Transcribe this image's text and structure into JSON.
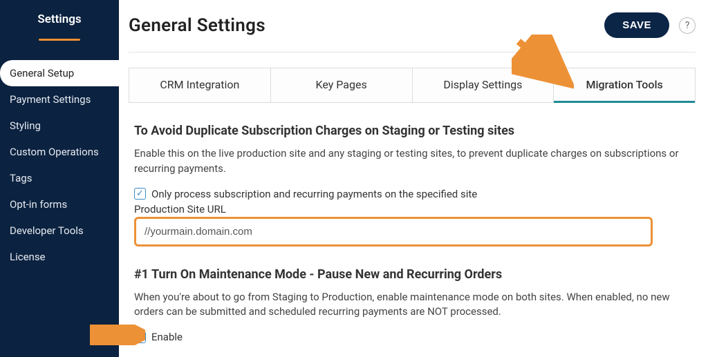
{
  "sidebar": {
    "title": "Settings",
    "items": [
      {
        "label": "General Setup",
        "active": true
      },
      {
        "label": "Payment Settings"
      },
      {
        "label": "Styling"
      },
      {
        "label": "Custom Operations"
      },
      {
        "label": "Tags"
      },
      {
        "label": "Opt-in forms"
      },
      {
        "label": "Developer Tools"
      },
      {
        "label": "License"
      }
    ]
  },
  "header": {
    "title": "General Settings",
    "save_label": "SAVE",
    "help_label": "?"
  },
  "tabs": [
    {
      "label": "CRM Integration"
    },
    {
      "label": "Key Pages"
    },
    {
      "label": "Display Settings"
    },
    {
      "label": "Migration Tools",
      "active": true
    }
  ],
  "section_dup": {
    "title": "To Avoid Duplicate Subscription Charges on Staging or Testing sites",
    "desc": "Enable this on the live production site and any staging or testing sites, to prevent duplicate charges on subscriptions or recurring payments.",
    "checkbox_label": "Only process subscription and recurring payments on the specified site",
    "url_label": "Production Site URL",
    "url_value": "//yourmain.domain.com"
  },
  "section_maint": {
    "title": "#1 Turn On Maintenance Mode - Pause New and Recurring Orders",
    "desc": "When you're about to go from Staging to Production, enable maintenance mode on both sites. When enabled, no new orders can be submitted and scheduled recurring payments are NOT processed.",
    "checkbox_label": "Enable"
  },
  "colors": {
    "accent": "#ed9136",
    "tab_active": "#1f8a94",
    "sidebar_bg": "#0b2240"
  }
}
